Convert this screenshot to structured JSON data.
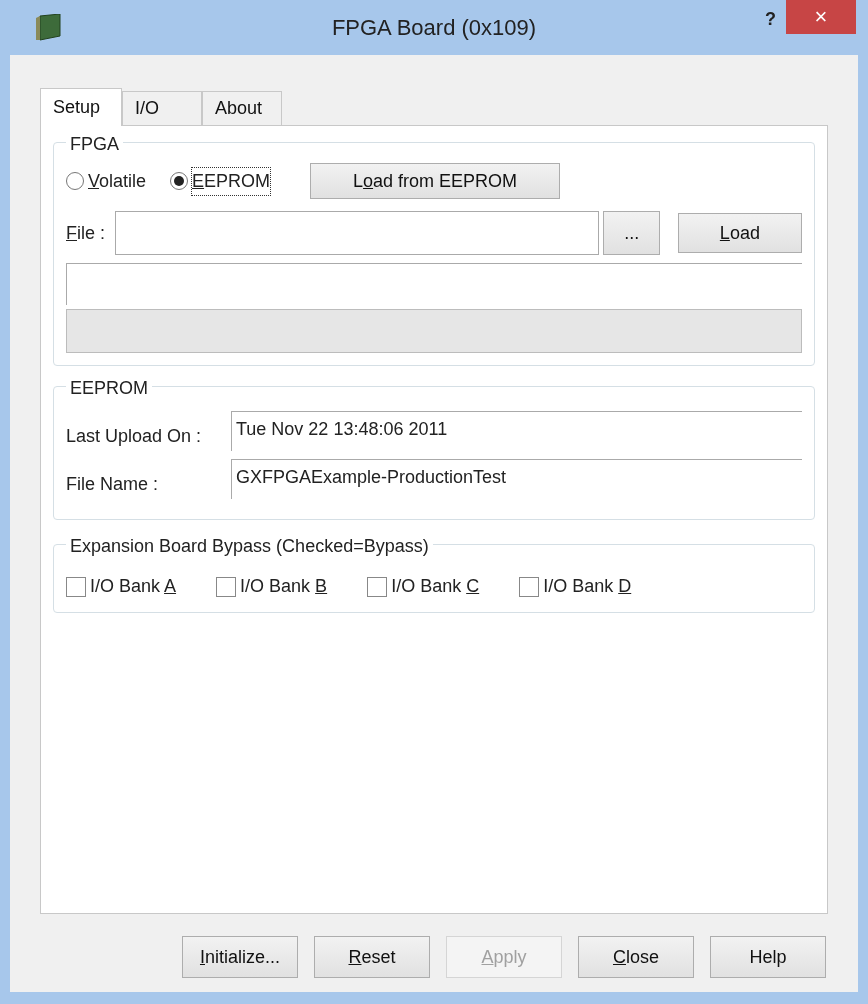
{
  "window": {
    "title": "FPGA Board (0x109)",
    "help": "?",
    "close": "×"
  },
  "tabs": [
    {
      "label": "Setup",
      "selected": true
    },
    {
      "label": "I/O",
      "selected": false
    },
    {
      "label": "About",
      "selected": false
    }
  ],
  "fpga": {
    "title": "FPGA",
    "modes": [
      {
        "label": {
          "key": "V",
          "after": "olatile"
        },
        "selected": false
      },
      {
        "label": {
          "key": "E",
          "after": "EPROM"
        },
        "selected": true
      }
    ],
    "load_eeprom_button": {
      "before": "L",
      "key": "o",
      "after": "ad from EEPROM"
    },
    "file_label": {
      "key": "F",
      "after": "ile :"
    },
    "browse_button": "...",
    "load_button": {
      "key": "L",
      "after": "oad"
    },
    "progress": {
      "level": 0
    }
  },
  "eeprom": {
    "title": "EEPROM",
    "fields": [
      {
        "label": "Last Upload On :",
        "value": "Tue Nov 22 13:48:06 2011"
      },
      {
        "label": "File Name :",
        "value": "GXFPGAExample-ProductionTest"
      }
    ]
  },
  "bypass": {
    "title": "Expansion Board Bypass (Checked=Bypass)",
    "banks": [
      {
        "label": {
          "before": "I/O Bank ",
          "key": "A"
        },
        "checked": false
      },
      {
        "label": {
          "before": "I/O Bank ",
          "key": "B"
        },
        "checked": false
      },
      {
        "label": {
          "before": "I/O Bank ",
          "key": "C"
        },
        "checked": false
      },
      {
        "label": {
          "before": "I/O Bank ",
          "key": "D"
        },
        "checked": false
      }
    ]
  },
  "buttons": [
    {
      "label": {
        "key": "I",
        "after": "nitialize..."
      },
      "disabled": false
    },
    {
      "label": {
        "key": "R",
        "after": "eset"
      },
      "disabled": false
    },
    {
      "label": {
        "key": "A",
        "after": "pply"
      },
      "disabled": true
    },
    {
      "label": {
        "key": "C",
        "after": "lose"
      },
      "disabled": false
    },
    {
      "label": {
        "before": "Help"
      },
      "disabled": false
    }
  ]
}
